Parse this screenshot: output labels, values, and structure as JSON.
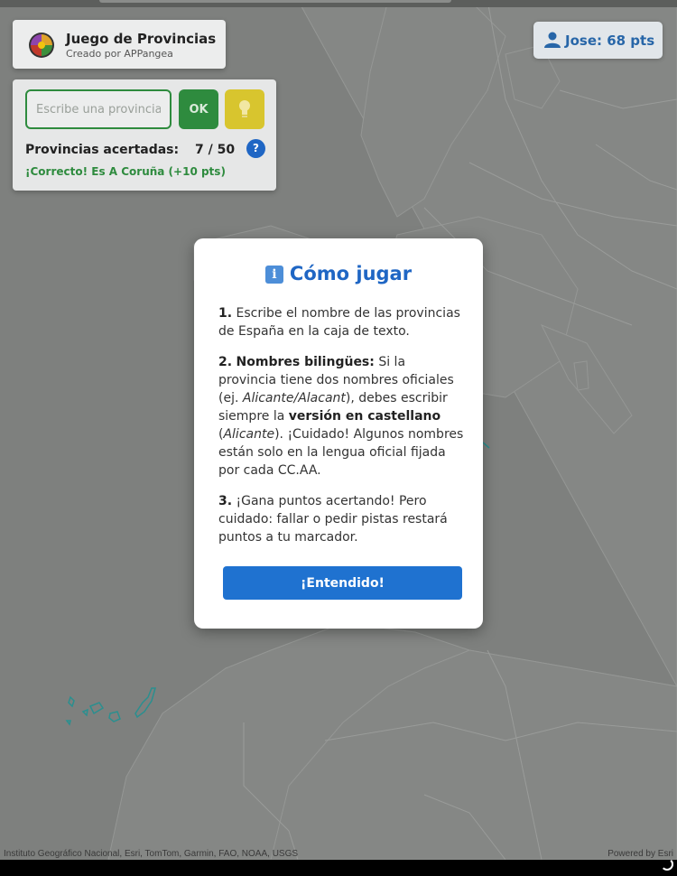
{
  "brand": {
    "title": "Juego de Provincias",
    "subtitle": "Creado por APPangea"
  },
  "score": {
    "label": "Jose: 68 pts",
    "icon": "user-icon"
  },
  "panel": {
    "input_placeholder": "Escribe una provincia",
    "input_value": "",
    "ok_label": "OK",
    "hint_icon": "lightbulb-icon",
    "count_label": "Provincias acertadas:",
    "count_value": "7 / 50",
    "help_label": "?",
    "feedback": "¡Correcto! Es A Coruña (+10 pts)"
  },
  "modal": {
    "title": "Cómo jugar",
    "title_icon": "info-icon",
    "p1_num": "1.",
    "p1_text": " Escribe el nombre de las provincias de España en la caja de texto.",
    "p2_num": "2.",
    "p2_lead": "Nombres bilingües:",
    "p2_a": " Si la provincia tiene dos nombres oficiales (ej. ",
    "p2_example": "Alicante/Alacant",
    "p2_b": "), debes escribir siempre la ",
    "p2_strong": "versión en castellano",
    "p2_c": " (",
    "p2_example2": "Alicante",
    "p2_d": "). ¡Cuidado! Algunos nombres están solo en la lengua oficial fijada por cada CC.AA.",
    "p3_num": "3.",
    "p3_text": " ¡Gana puntos acertando! Pero cuidado: fallar o pedir pistas restará puntos a tu marcador.",
    "button": "¡Entendido!"
  },
  "map": {
    "attribution_left": "Instituto Geográfico Nacional, Esri, TomTom, Garmin, FAO, NOAA, USGS",
    "attribution_right": "Powered by Esri"
  },
  "colors": {
    "accent_blue": "#1f66c4",
    "success_green": "#2e8b3e",
    "hint_yellow": "#d8c52e"
  }
}
